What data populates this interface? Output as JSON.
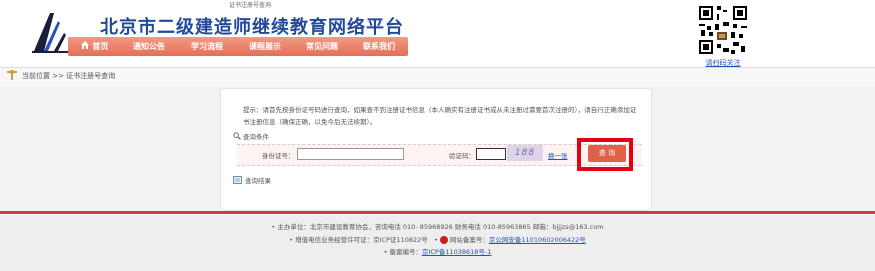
{
  "page_title": "证书注册号查询",
  "site": {
    "name": "北京市二级建造师继续教育网络平台"
  },
  "nav": {
    "items": [
      {
        "label": "首页",
        "icon": "home-icon"
      },
      {
        "label": "通知公告"
      },
      {
        "label": "学习流程"
      },
      {
        "label": "课程展示"
      },
      {
        "label": "常见问题"
      },
      {
        "label": "联系我们"
      }
    ]
  },
  "qr": {
    "caption": "请扫码关注"
  },
  "breadcrumb": {
    "text": "当前位置 >> 证书注册号查询"
  },
  "notice": {
    "text": "提示：请首先按身份证号码进行查询，如果查不到注册证书信息（本人确实有注册证书或从未注册过需要首次注册的），请自行正确添加证书注册信息（确保正确，以免今后无法续期）。"
  },
  "query_section": {
    "title": "查询条件",
    "id_label": "身份证号：",
    "id_value": "",
    "code_label": "验证码：",
    "code_value": "",
    "captcha_text": "188",
    "refresh_label": "换一张",
    "submit_label": "查 询"
  },
  "results_section": {
    "title": "查询结果"
  },
  "footer": {
    "sponsor": "主办单位：北京市建设教育协会，咨询电话 010- 85968926  财务电话 010-85963865  邮箱：bjjjzs@163.com",
    "icp_license": "增值电信业务经营许可证：京ICP证110822号",
    "police_label": "网站备案号：",
    "police_link": "京公网安备11010602006422号",
    "record_label": "备案编号：",
    "record_link": "京ICP备11038618号-1"
  },
  "colors": {
    "nav_bg": "#e56f55",
    "title_blue": "#234a9a",
    "highlight_red": "#e50012",
    "query_button": "#e06148"
  }
}
